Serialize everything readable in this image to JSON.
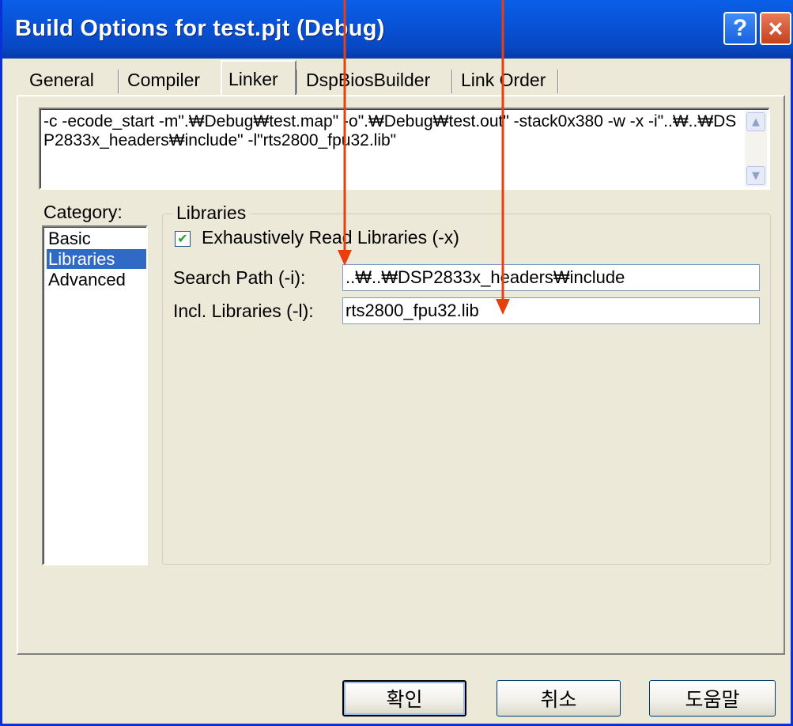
{
  "window": {
    "title": "Build Options for test.pjt (Debug)",
    "help_glyph": "?",
    "close_glyph": "×"
  },
  "tabs": [
    {
      "label": "General",
      "active": false
    },
    {
      "label": "Compiler",
      "active": false
    },
    {
      "label": "Linker",
      "active": true
    },
    {
      "label": "DspBiosBuilder",
      "active": false
    },
    {
      "label": "Link Order",
      "active": false
    }
  ],
  "command_line": "-c -ecode_start -m\".₩Debug₩test.map\" -o\".₩Debug₩test.out\" -stack0x380 -w -x -i\"..₩..₩DSP2833x_headers₩include\" -l\"rts2800_fpu32.lib\"",
  "category": {
    "label": "Category:",
    "items": [
      {
        "label": "Basic",
        "selected": false
      },
      {
        "label": "Libraries",
        "selected": true
      },
      {
        "label": "Advanced",
        "selected": false
      }
    ]
  },
  "libraries": {
    "group_title": "Libraries",
    "exhaustive_read": {
      "label": "Exhaustively Read Libraries (-x)",
      "checked": true,
      "check_glyph": "✔"
    },
    "search_path": {
      "label": "Search Path (-i):",
      "value": "..₩..₩DSP2833x_headers₩include"
    },
    "incl_libraries": {
      "label": "Incl. Libraries (-l):",
      "value": "rts2800_fpu32.lib"
    }
  },
  "buttons": {
    "ok": "확인",
    "cancel": "취소",
    "help": "도움말"
  },
  "colors": {
    "annotation_arrow": "#e8400c",
    "title_bar": "#0853d8",
    "selection": "#316ac5"
  }
}
